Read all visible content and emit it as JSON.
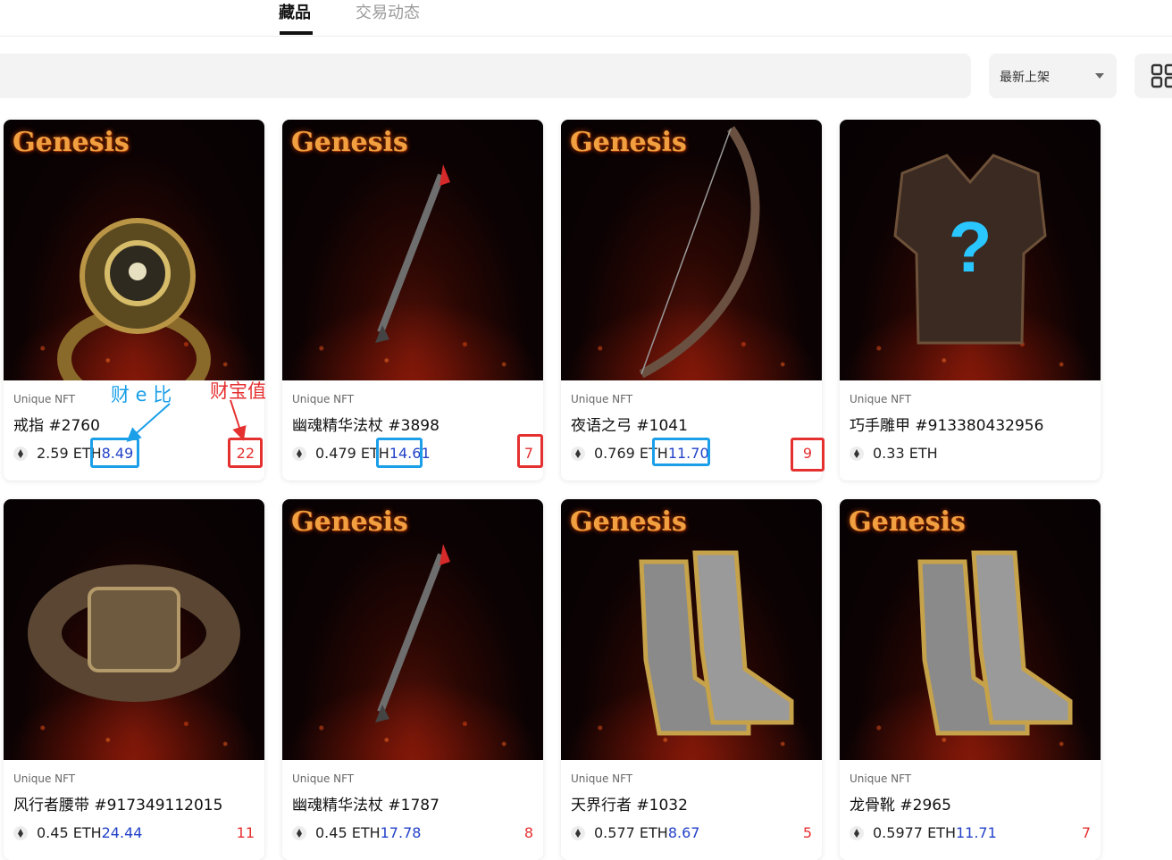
{
  "tabs": [
    {
      "label": "藏品",
      "active": true
    },
    {
      "label": "交易动态",
      "active": false
    }
  ],
  "search": {
    "placeholder": ""
  },
  "sort": {
    "selected": "最新上架"
  },
  "view_toggle_icon": "grid-icon",
  "cards": [
    {
      "type": "Unique NFT",
      "name": "戒指 #2760",
      "price": "2.59 ETH",
      "ratio": "8.49",
      "treasure": "22",
      "item_icon": "ring-icon",
      "has_genesis": true,
      "genesis": "Genesis"
    },
    {
      "type": "Unique NFT",
      "name": "幽魂精华法杖 #3898",
      "price": "0.479 ETH",
      "ratio": "14.61",
      "treasure": "7",
      "item_icon": "staff-icon",
      "has_genesis": true,
      "genesis": "Genesis"
    },
    {
      "type": "Unique NFT",
      "name": "夜语之弓 #1041",
      "price": "0.769 ETH",
      "ratio": "11.70",
      "treasure": "9",
      "item_icon": "bow-icon",
      "has_genesis": true,
      "genesis": "Genesis"
    },
    {
      "type": "Unique NFT",
      "name": "巧手雕甲 #913380432956",
      "price": "0.33 ETH",
      "ratio": "",
      "treasure": "",
      "item_icon": "armor-icon",
      "has_genesis": false,
      "genesis": ""
    },
    {
      "type": "Unique NFT",
      "name": "风行者腰带 #917349112015",
      "price": "0.45 ETH",
      "ratio": "24.44",
      "treasure": "11",
      "item_icon": "belt-icon",
      "has_genesis": false,
      "genesis": ""
    },
    {
      "type": "Unique NFT",
      "name": "幽魂精华法杖 #1787",
      "price": "0.45 ETH",
      "ratio": "17.78",
      "treasure": "8",
      "item_icon": "staff-icon",
      "has_genesis": true,
      "genesis": "Genesis"
    },
    {
      "type": "Unique NFT",
      "name": "天界行者 #1032",
      "price": "0.577 ETH",
      "ratio": "8.67",
      "treasure": "5",
      "item_icon": "boots-icon",
      "has_genesis": true,
      "genesis": "Genesis"
    },
    {
      "type": "Unique NFT",
      "name": "龙骨靴 #2965",
      "price": "0.5977 ETH",
      "ratio": "11.71",
      "treasure": "7",
      "item_icon": "boots-icon",
      "has_genesis": true,
      "genesis": "Genesis"
    }
  ],
  "annotations": {
    "ratio_label": "财 e 比",
    "treasure_label": "财宝值"
  },
  "colors": {
    "ratio_text": "#2342c9",
    "treasure_text": "#e53030",
    "highlight_blue": "#1a9fe8",
    "highlight_red": "#e53030"
  }
}
